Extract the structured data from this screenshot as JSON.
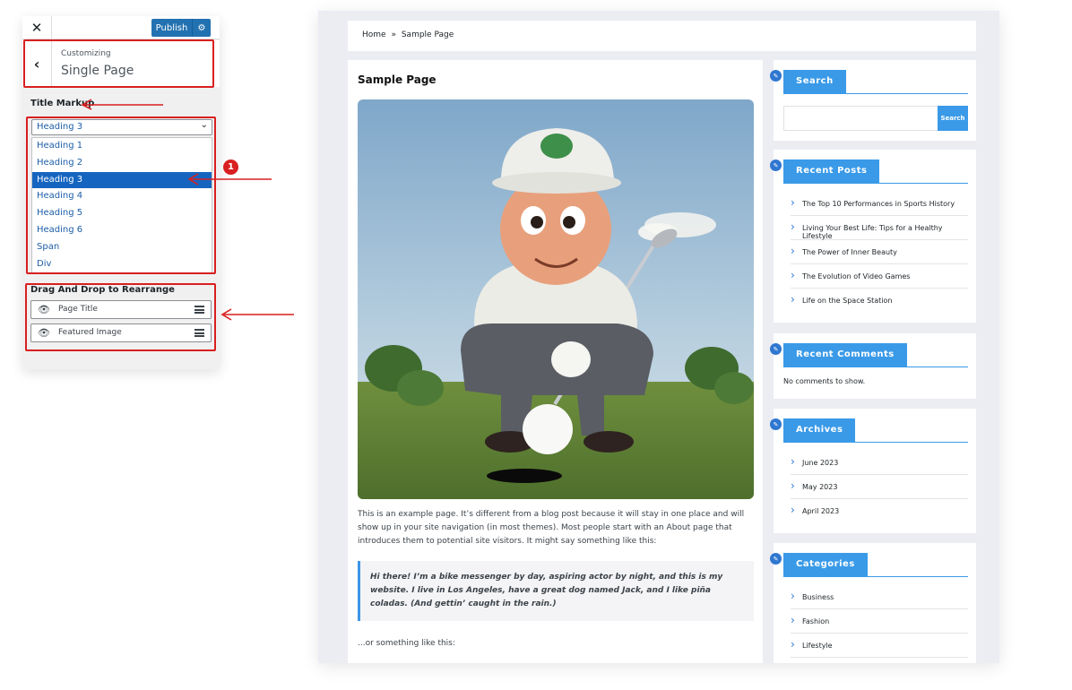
{
  "customizer": {
    "close_glyph": "✕",
    "publish_label": "Publish",
    "customizing": "Customizing",
    "section_title": "Single Page",
    "title_markup_label": "Title Markup",
    "select_value": "Heading 3",
    "options": [
      "Heading 1",
      "Heading 2",
      "Heading 3",
      "Heading 4",
      "Heading 5",
      "Heading 6",
      "Span",
      "Div"
    ],
    "drag_label": "Drag And Drop to Rearrange",
    "drag_items": [
      "Page Title",
      "Featured Image"
    ]
  },
  "annotations": {
    "badge_1": "1",
    "badge_2": "1"
  },
  "site": {
    "breadcrumb": {
      "home": "Home",
      "sep": "»",
      "current": "Sample Page"
    },
    "page_title": "Sample Page",
    "paragraph": "This is an example page. It’s different from a blog post because it will stay in one place and will show up in your site navigation (in most themes). Most people start with an About page that introduces them to potential site visitors. It might say something like this:",
    "quote": "Hi there! I’m a bike messenger by day, aspiring actor by night, and this is my website. I live in Los Angeles, have a great dog named Jack, and I like piña coladas. (And gettin’ caught in the rain.)",
    "or_more": "...or something like this:",
    "widgets": {
      "search": {
        "title": "Search",
        "button": "Search"
      },
      "recent_posts": {
        "title": "Recent Posts",
        "items": [
          "The Top 10 Performances in Sports History",
          "Living Your Best Life: Tips for a Healthy Lifestyle",
          "The Power of Inner Beauty",
          "The Evolution of Video Games",
          "Life on the Space Station"
        ]
      },
      "recent_comments": {
        "title": "Recent Comments",
        "empty": "No comments to show."
      },
      "archives": {
        "title": "Archives",
        "items": [
          "June 2023",
          "May 2023",
          "April 2023"
        ]
      },
      "categories": {
        "title": "Categories",
        "items": [
          "Business",
          "Fashion",
          "Lifestyle"
        ]
      }
    }
  },
  "colors": {
    "accent": "#3a9ae8",
    "annotation": "#d91f1f",
    "publish": "#2271b1",
    "selected_option": "#1565c0"
  }
}
